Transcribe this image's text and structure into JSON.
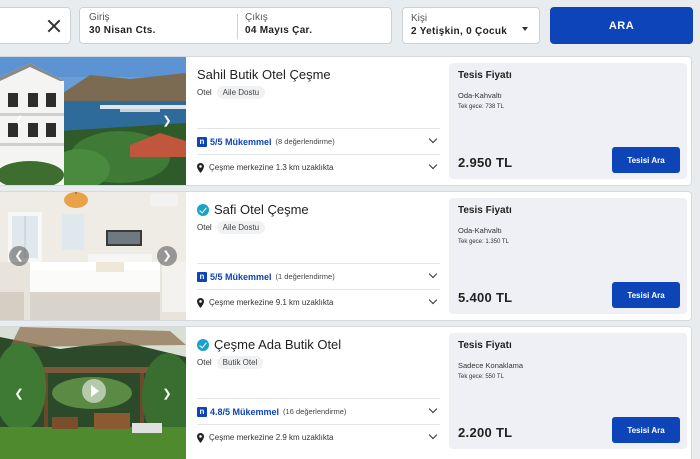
{
  "search": {
    "checkin_label": "Giriş",
    "checkin_value": "30 Nisan Cts.",
    "checkout_label": "Çıkış",
    "checkout_value": "04 Mayıs Çar.",
    "guests_label": "Kişi",
    "guests_value": "2 Yetişkin, 0 Çocuk",
    "search_button": "ARA"
  },
  "hotels": [
    {
      "name": "Sahil Butik Otel Çeşme",
      "verified": false,
      "type": "Otel",
      "badge": "Aile Dostu",
      "score": "5/5 Mükemmel",
      "reviews": "(8 değerlendirme)",
      "distance": "Çeşme merkezine 1.3 km uzaklıkta",
      "price_title": "Tesis Fiyatı",
      "board": "Oda-Kahvaltı",
      "per_night": "Tek gece: 738 TL",
      "price": "2.950 TL",
      "button": "Tesisi Ara"
    },
    {
      "name": "Safi Otel Çeşme",
      "verified": true,
      "type": "Otel",
      "badge": "Aile Dostu",
      "score": "5/5 Mükemmel",
      "reviews": "(1 değerlendirme)",
      "distance": "Çeşme merkezine 9.1 km uzaklıkta",
      "price_title": "Tesis Fiyatı",
      "board": "Oda-Kahvaltı",
      "per_night": "Tek gece: 1.350 TL",
      "price": "5.400 TL",
      "button": "Tesisi Ara"
    },
    {
      "name": "Çeşme Ada Butik Otel",
      "verified": true,
      "type": "Otel",
      "badge": "Butik Otel",
      "score": "4.8/5 Mükemmel",
      "reviews": "(16 değerlendirme)",
      "distance": "Çeşme merkezine 2.9 km uzaklıkta",
      "price_title": "Tesis Fiyatı",
      "board": "Sadece Konaklama",
      "per_night": "Tek gece: 550 TL",
      "price": "2.200 TL",
      "button": "Tesisi Ara"
    }
  ],
  "icons": {
    "close": "close-icon",
    "dropdown": "chevron-down-icon",
    "rating_logo": "n-logo-icon",
    "location": "map-pin-icon",
    "verified": "verified-check-icon",
    "gallery_prev": "chevron-left-icon",
    "gallery_next": "chevron-right-icon",
    "video": "play-icon"
  },
  "colors": {
    "brand_blue": "#0d44b8",
    "verified_teal": "#1aa3c8",
    "page_bg": "#e9ecef",
    "price_box_bg": "#eef0f5"
  }
}
